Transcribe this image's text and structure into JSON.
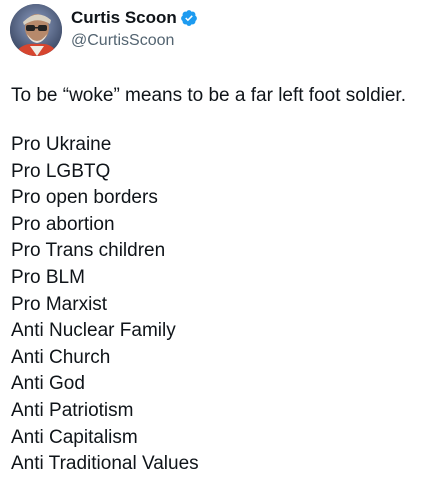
{
  "author": {
    "display_name": "Curtis Scoon",
    "handle": "@CurtisScoon",
    "verified": true,
    "verified_color": "#1d9bf0",
    "avatar_icon": "profile-avatar"
  },
  "post": {
    "lead": "To be “woke” means to be a far left foot soldier.",
    "items": [
      "Pro Ukraine",
      "Pro LGBTQ",
      "Pro open borders",
      "Pro abortion",
      "Pro Trans children",
      "Pro BLM",
      "Pro Marxist",
      "Anti Nuclear Family",
      "Anti Church",
      "Anti God",
      "Anti Patriotism",
      "Anti Capitalism",
      "Anti Traditional Values"
    ]
  },
  "colors": {
    "text": "#0f1419",
    "secondary_text": "#536471",
    "background": "#ffffff"
  }
}
